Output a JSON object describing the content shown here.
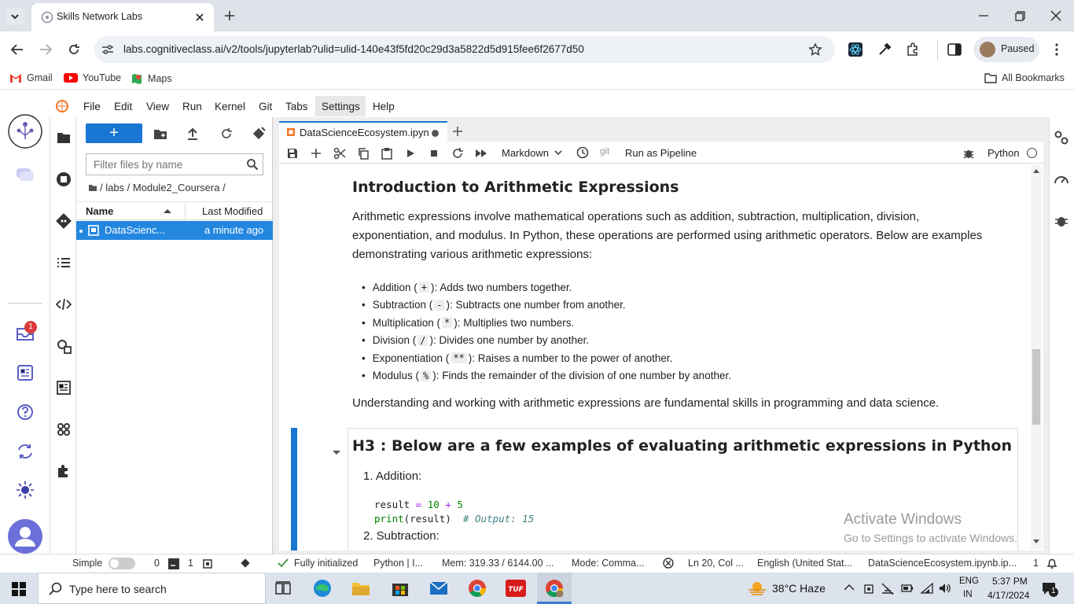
{
  "browser": {
    "tab_title": "Skills Network Labs",
    "url": "labs.cognitiveclass.ai/v2/tools/jupyterlab?ulid=ulid-140e43f5fd20c29d3a5822d5d915fee6f2677d50",
    "profile_status": "Paused",
    "bookmarks": [
      "Gmail",
      "YouTube",
      "Maps"
    ],
    "all_bookmarks": "All Bookmarks"
  },
  "jupyter": {
    "menu": [
      "File",
      "Edit",
      "View",
      "Run",
      "Kernel",
      "Git",
      "Tabs",
      "Settings",
      "Help"
    ],
    "new_button": "+",
    "filter_placeholder": "Filter files by name",
    "breadcrumb": "/ labs / Module2_Coursera /",
    "columns": {
      "name": "Name",
      "modified": "Last Modified"
    },
    "files": [
      {
        "name": "DataScienc...",
        "modified": "a minute ago"
      }
    ],
    "notebook_tab": "DataScienceEcosystem.ipyn",
    "cell_type": "Markdown",
    "git_label": "git",
    "run_pipeline": "Run as Pipeline",
    "kernel": "Python",
    "notification_badge": "1"
  },
  "notebook": {
    "heading": "Introduction to Arithmetic Expressions",
    "paragraph": "Arithmetic expressions involve mathematical operations such as addition, subtraction, multiplication, division, exponentiation, and modulus. In Python, these operations are performed using arithmetic operators. Below are examples demonstrating various arithmetic expressions:",
    "items": [
      {
        "name": "Addition (",
        "op": "+",
        "desc": "): Adds two numbers together."
      },
      {
        "name": "Subtraction (",
        "op": "-",
        "desc": "): Subtracts one number from another."
      },
      {
        "name": "Multiplication (",
        "op": "*",
        "desc": "): Multiplies two numbers."
      },
      {
        "name": "Division (",
        "op": "/",
        "desc": "): Divides one number by another."
      },
      {
        "name": "Exponentiation (",
        "op": "**",
        "desc": "): Raises a number to the power of another."
      },
      {
        "name": "Modulus (",
        "op": "%",
        "desc": "): Finds the remainder of the division of one number by another."
      }
    ],
    "summary": "Understanding and working with arithmetic expressions are fundamental skills in programming and data science.",
    "h3": "H3 : Below are a few examples of evaluating arithmetic expressions in Python",
    "ol1": "1. Addition:",
    "code_var": "result",
    "code_eq": " = ",
    "code_n1": "10",
    "code_plus": " + ",
    "code_n2": "5",
    "code_print": "print",
    "code_args": "(result)",
    "code_comment": "# Output: 15",
    "ol2": "2. Subtraction:",
    "watermark_title": "Activate Windows",
    "watermark_sub": "Go to Settings to activate Windows."
  },
  "status": {
    "mode": "Simple",
    "terminals": "0",
    "kernels": "1",
    "init": "Fully initialized",
    "kernel": "Python | I...",
    "mem": "Mem: 319.33 / 6144.00 ...",
    "cmd_mode": "Mode: Comma...",
    "position": "Ln 20, Col ...",
    "language": "English (United Stat...",
    "filename": "DataScienceEcosystem.ipynb.ip...",
    "count": "1"
  },
  "taskbar": {
    "search_placeholder": "Type here to search",
    "weather": "38°C  Haze",
    "lang1": "ENG",
    "lang2": "IN",
    "time": "5:37 PM",
    "date": "4/17/2024",
    "notif": "1"
  }
}
